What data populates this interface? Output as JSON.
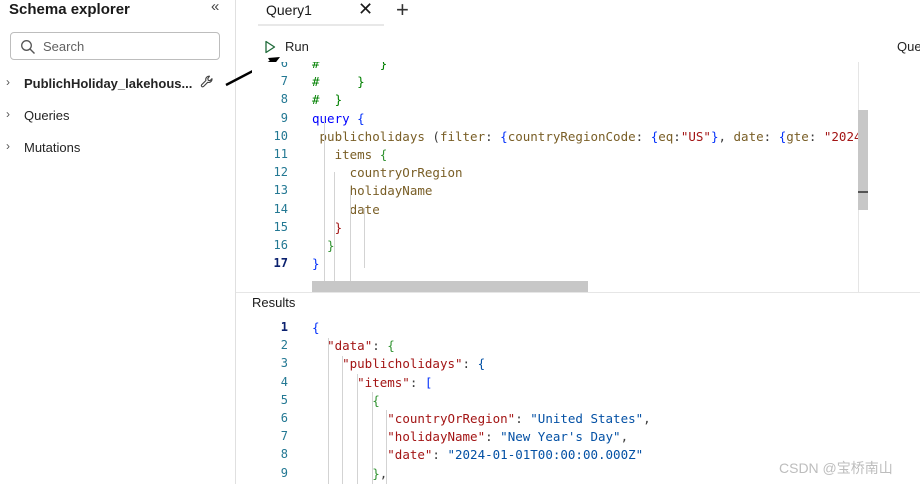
{
  "sidebar": {
    "title": "Schema explorer",
    "collapse_icon": "«",
    "search_placeholder": "Search",
    "items": [
      {
        "label": "PublichHoliday_lakehous...",
        "bold": true
      },
      {
        "label": "Queries",
        "bold": false
      },
      {
        "label": "Mutations",
        "bold": false
      }
    ]
  },
  "tabs": {
    "active_label": "Query1",
    "close_glyph": "✕",
    "add_glyph": "+"
  },
  "toolbar": {
    "run_label": "Run",
    "right_cut_label": "Que"
  },
  "editor": {
    "line_numbers": [
      "6",
      "7",
      "8",
      "9",
      "10",
      "11",
      "12",
      "13",
      "14",
      "15",
      "16",
      "17"
    ],
    "lines": [
      {
        "segments": [
          {
            "t": "#",
            "c": "c-com"
          },
          {
            "t": "        }",
            "c": "c-com"
          }
        ]
      },
      {
        "segments": [
          {
            "t": "#     }",
            "c": "c-com"
          }
        ]
      },
      {
        "segments": [
          {
            "t": "#  }",
            "c": "c-com"
          }
        ]
      },
      {
        "segments": [
          {
            "t": "query ",
            "c": "c-kw"
          },
          {
            "t": "{",
            "c": "c-br"
          }
        ]
      },
      {
        "segments": [
          {
            "t": " publicholidays ",
            "c": "c-fn"
          },
          {
            "t": "(",
            "c": "c-plain"
          },
          {
            "t": "filter",
            "c": "c-fn"
          },
          {
            "t": ": ",
            "c": "c-plain"
          },
          {
            "t": "{",
            "c": "c-br"
          },
          {
            "t": "countryRegionCode",
            "c": "c-fn"
          },
          {
            "t": ": ",
            "c": "c-plain"
          },
          {
            "t": "{",
            "c": "c-br"
          },
          {
            "t": "eq",
            "c": "c-fn"
          },
          {
            "t": ":",
            "c": "c-plain"
          },
          {
            "t": "\"US\"",
            "c": "c-str"
          },
          {
            "t": "}",
            "c": "c-br"
          },
          {
            "t": ", ",
            "c": "c-plain"
          },
          {
            "t": "date",
            "c": "c-fn"
          },
          {
            "t": ": ",
            "c": "c-plain"
          },
          {
            "t": "{",
            "c": "c-br"
          },
          {
            "t": "gte",
            "c": "c-fn"
          },
          {
            "t": ": ",
            "c": "c-plain"
          },
          {
            "t": "\"2024-",
            "c": "c-str"
          }
        ]
      },
      {
        "segments": [
          {
            "t": "   items ",
            "c": "c-fn"
          },
          {
            "t": "{",
            "c": "c-green"
          }
        ]
      },
      {
        "segments": [
          {
            "t": "     countryOrRegion",
            "c": "c-fld"
          }
        ]
      },
      {
        "segments": [
          {
            "t": "     holidayName",
            "c": "c-fld"
          }
        ]
      },
      {
        "segments": [
          {
            "t": "     date",
            "c": "c-fld"
          }
        ]
      },
      {
        "segments": [
          {
            "t": "   }",
            "c": "c-str"
          }
        ]
      },
      {
        "segments": [
          {
            "t": "  }",
            "c": "c-green"
          }
        ]
      },
      {
        "segments": [
          {
            "t": "}",
            "c": "c-br"
          }
        ]
      }
    ]
  },
  "results": {
    "title": "Results",
    "line_numbers": [
      "1",
      "2",
      "3",
      "4",
      "5",
      "6",
      "7",
      "8",
      "9"
    ],
    "lines": [
      {
        "segments": [
          {
            "t": "{",
            "c": "j-br"
          }
        ]
      },
      {
        "segments": [
          {
            "t": "  ",
            "c": "j-p"
          },
          {
            "t": "\"data\"",
            "c": "j-key"
          },
          {
            "t": ": ",
            "c": "j-p"
          },
          {
            "t": "{",
            "c": "j-br2"
          }
        ]
      },
      {
        "segments": [
          {
            "t": "    ",
            "c": "j-p"
          },
          {
            "t": "\"publicholidays\"",
            "c": "j-key"
          },
          {
            "t": ": ",
            "c": "j-p"
          },
          {
            "t": "{",
            "c": "j-str"
          }
        ]
      },
      {
        "segments": [
          {
            "t": "      ",
            "c": "j-p"
          },
          {
            "t": "\"items\"",
            "c": "j-key"
          },
          {
            "t": ": ",
            "c": "j-p"
          },
          {
            "t": "[",
            "c": "j-br"
          }
        ]
      },
      {
        "segments": [
          {
            "t": "        ",
            "c": "j-p"
          },
          {
            "t": "{",
            "c": "j-br2"
          }
        ]
      },
      {
        "segments": [
          {
            "t": "          ",
            "c": "j-p"
          },
          {
            "t": "\"countryOrRegion\"",
            "c": "j-key"
          },
          {
            "t": ": ",
            "c": "j-p"
          },
          {
            "t": "\"United States\"",
            "c": "j-str"
          },
          {
            "t": ",",
            "c": "j-p"
          }
        ]
      },
      {
        "segments": [
          {
            "t": "          ",
            "c": "j-p"
          },
          {
            "t": "\"holidayName\"",
            "c": "j-key"
          },
          {
            "t": ": ",
            "c": "j-p"
          },
          {
            "t": "\"New Year's Day\"",
            "c": "j-str"
          },
          {
            "t": ",",
            "c": "j-p"
          }
        ]
      },
      {
        "segments": [
          {
            "t": "          ",
            "c": "j-p"
          },
          {
            "t": "\"date\"",
            "c": "j-key"
          },
          {
            "t": ": ",
            "c": "j-p"
          },
          {
            "t": "\"2024-01-01T00:00:00.000Z\"",
            "c": "j-str"
          }
        ]
      },
      {
        "segments": [
          {
            "t": "        ",
            "c": "j-p"
          },
          {
            "t": "}",
            "c": "j-br2"
          },
          {
            "t": ",",
            "c": "j-p"
          }
        ]
      }
    ]
  },
  "watermark": "CSDN @宝桥南山"
}
